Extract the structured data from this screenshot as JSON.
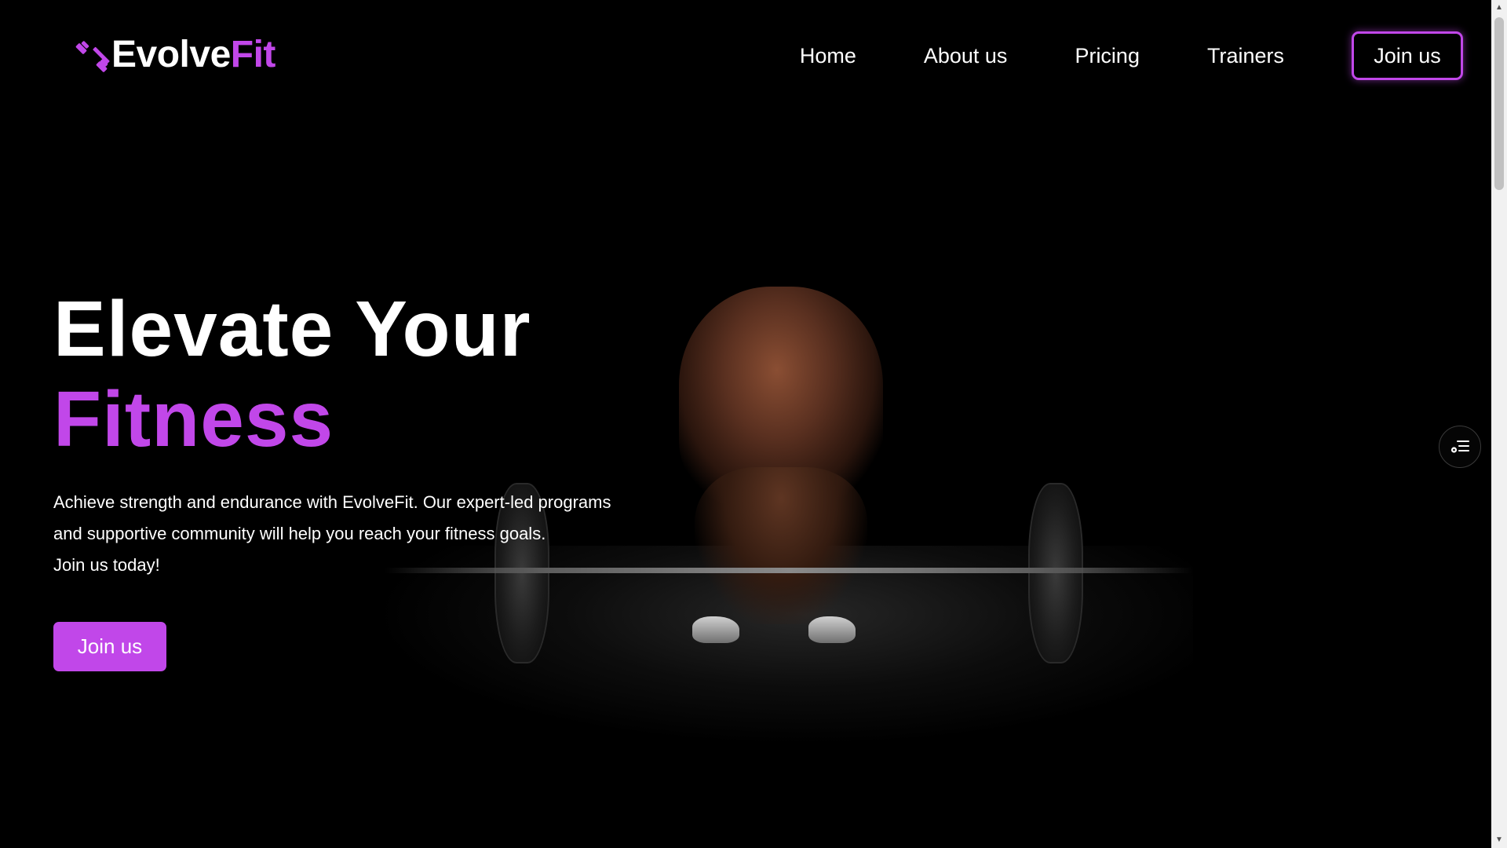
{
  "brand": {
    "name_part1": "Evolve",
    "name_part2": "Fit",
    "icon": "dumbbell-icon",
    "accent_color": "#c147e9"
  },
  "nav": {
    "items": [
      {
        "label": "Home"
      },
      {
        "label": "About us"
      },
      {
        "label": "Pricing"
      },
      {
        "label": "Trainers"
      }
    ],
    "cta_label": "Join us"
  },
  "hero": {
    "title_line1": "Elevate Your",
    "title_line2": "Fitness",
    "description_lines": [
      "Achieve strength and endurance with EvolveFit. Our expert-led programs",
      "and supportive community will help you reach your fitness goals.",
      "Join us today!"
    ],
    "cta_label": "Join us",
    "image_subject": "athlete performing barbell deadlift in dark gym"
  },
  "side_widget": {
    "icon": "list-settings-icon"
  },
  "scrollbar": {
    "up_icon": "arrow-up-icon",
    "down_icon": "arrow-down-icon"
  }
}
